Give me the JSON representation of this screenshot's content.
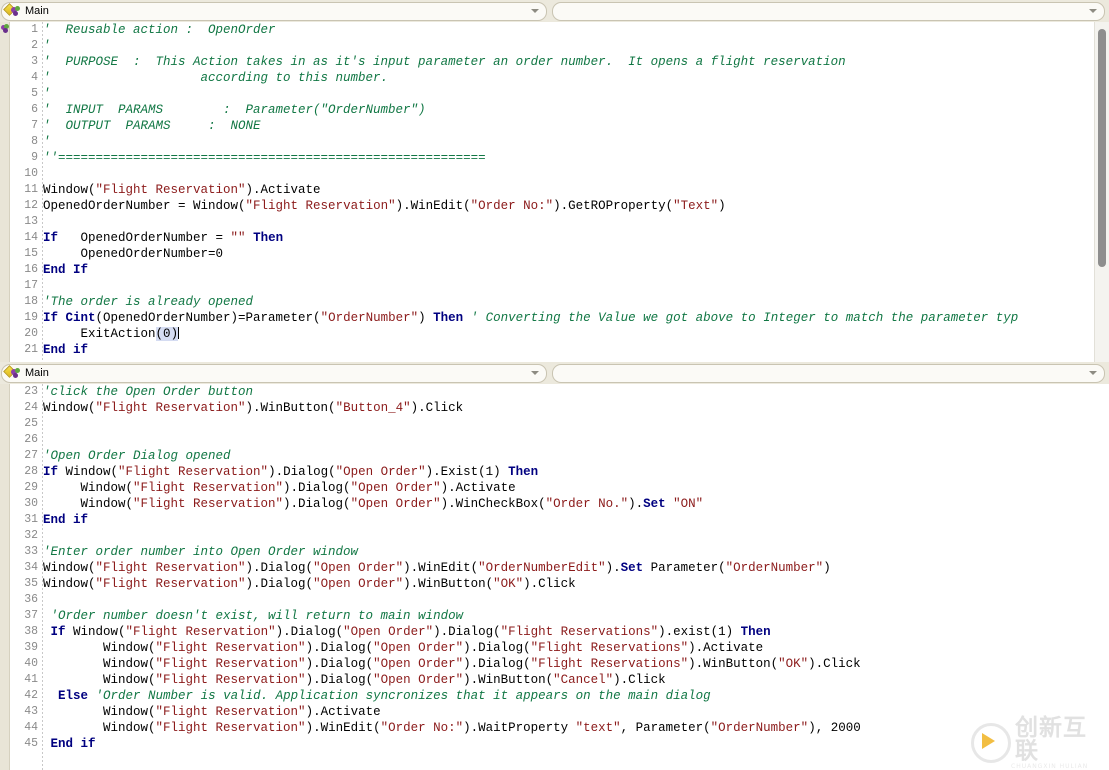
{
  "toolbar": {
    "action_combo": {
      "label": "Main",
      "icon": "action-flask-icon",
      "arrow_icon": "chevron-down-icon"
    },
    "method_combo": {
      "value": "",
      "arrow_icon": "chevron-down-icon"
    }
  },
  "pane_bottom_header": {
    "label": "Main",
    "icon": "action-flask-icon",
    "arrow_icon": "chevron-down-icon"
  },
  "editor_top": {
    "first_line_number": 1,
    "lines": [
      {
        "n": 1,
        "tokens": [
          {
            "t": "cm",
            "v": "'  Reusable action :  OpenOrder"
          }
        ]
      },
      {
        "n": 2,
        "tokens": [
          {
            "t": "cm",
            "v": "'"
          }
        ]
      },
      {
        "n": 3,
        "tokens": [
          {
            "t": "cm",
            "v": "'  PURPOSE  :  This Action takes in as it's input parameter an order number.  It opens a flight reservation"
          }
        ]
      },
      {
        "n": 4,
        "tokens": [
          {
            "t": "cm",
            "v": "'                    according to this number."
          }
        ]
      },
      {
        "n": 5,
        "tokens": [
          {
            "t": "cm",
            "v": "'"
          }
        ]
      },
      {
        "n": 6,
        "tokens": [
          {
            "t": "cm",
            "v": "'  INPUT  PARAMS        :  Parameter(\"OrderNumber\")"
          }
        ]
      },
      {
        "n": 7,
        "tokens": [
          {
            "t": "cm",
            "v": "'  OUTPUT  PARAMS     :  NONE"
          }
        ]
      },
      {
        "n": 8,
        "tokens": [
          {
            "t": "cm",
            "v": "'"
          }
        ]
      },
      {
        "n": 9,
        "tokens": [
          {
            "t": "cm",
            "v": "''========================================================="
          }
        ]
      },
      {
        "n": 10,
        "tokens": [
          {
            "t": "pl",
            "v": ""
          }
        ]
      },
      {
        "n": 11,
        "tokens": [
          {
            "t": "pl",
            "v": "Window("
          },
          {
            "t": "st",
            "v": "\"Flight Reservation\""
          },
          {
            "t": "pl",
            "v": ").Activate"
          }
        ]
      },
      {
        "n": 12,
        "tokens": [
          {
            "t": "pl",
            "v": "OpenedOrderNumber = Window("
          },
          {
            "t": "st",
            "v": "\"Flight Reservation\""
          },
          {
            "t": "pl",
            "v": ").WinEdit("
          },
          {
            "t": "st",
            "v": "\"Order No:\""
          },
          {
            "t": "pl",
            "v": ").GetROProperty("
          },
          {
            "t": "st",
            "v": "\"Text\""
          },
          {
            "t": "pl",
            "v": ")"
          }
        ]
      },
      {
        "n": 13,
        "tokens": [
          {
            "t": "pl",
            "v": ""
          }
        ]
      },
      {
        "n": 14,
        "tokens": [
          {
            "t": "kw",
            "v": "If"
          },
          {
            "t": "pl",
            "v": "   OpenedOrderNumber = "
          },
          {
            "t": "st",
            "v": "\"\""
          },
          {
            "t": "pl",
            "v": " "
          },
          {
            "t": "kw",
            "v": "Then"
          }
        ]
      },
      {
        "n": 15,
        "tokens": [
          {
            "t": "pl",
            "v": "     OpenedOrderNumber=0"
          }
        ]
      },
      {
        "n": 16,
        "tokens": [
          {
            "t": "kw",
            "v": "End If"
          }
        ]
      },
      {
        "n": 17,
        "tokens": [
          {
            "t": "pl",
            "v": ""
          }
        ]
      },
      {
        "n": 18,
        "tokens": [
          {
            "t": "cm",
            "v": "'The order is already opened"
          }
        ]
      },
      {
        "n": 19,
        "tokens": [
          {
            "t": "kw",
            "v": "If Cint"
          },
          {
            "t": "pl",
            "v": "(OpenedOrderNumber)=Parameter("
          },
          {
            "t": "st",
            "v": "\"OrderNumber\""
          },
          {
            "t": "pl",
            "v": ") "
          },
          {
            "t": "kw",
            "v": "Then"
          },
          {
            "t": "pl",
            "v": " "
          },
          {
            "t": "cm",
            "v": "' Converting the Value we got above to Integer to match the parameter typ"
          }
        ]
      },
      {
        "n": 20,
        "tokens": [
          {
            "t": "pl",
            "v": "     ExitAction"
          },
          {
            "t": "brk",
            "v": "("
          },
          {
            "t": "brk2",
            "v": "0"
          },
          {
            "t": "brk",
            "v": ")"
          },
          {
            "t": "caret",
            "v": ""
          }
        ]
      },
      {
        "n": 21,
        "tokens": [
          {
            "t": "kw",
            "v": "End if"
          }
        ]
      }
    ],
    "scrollbar": {
      "thumb_top_pct": 2,
      "thumb_height_pct": 70
    }
  },
  "editor_bottom": {
    "first_line_number": 23,
    "lines": [
      {
        "n": 23,
        "tokens": [
          {
            "t": "cm",
            "v": "'click the Open Order button"
          }
        ]
      },
      {
        "n": 24,
        "tokens": [
          {
            "t": "pl",
            "v": "Window("
          },
          {
            "t": "st",
            "v": "\"Flight Reservation\""
          },
          {
            "t": "pl",
            "v": ").WinButton("
          },
          {
            "t": "st",
            "v": "\"Button_4\""
          },
          {
            "t": "pl",
            "v": ").Click"
          }
        ]
      },
      {
        "n": 25,
        "tokens": [
          {
            "t": "pl",
            "v": ""
          }
        ]
      },
      {
        "n": 26,
        "tokens": [
          {
            "t": "pl",
            "v": ""
          }
        ]
      },
      {
        "n": 27,
        "tokens": [
          {
            "t": "cm",
            "v": "'Open Order Dialog opened"
          }
        ]
      },
      {
        "n": 28,
        "tokens": [
          {
            "t": "kw",
            "v": "If"
          },
          {
            "t": "pl",
            "v": " Window("
          },
          {
            "t": "st",
            "v": "\"Flight Reservation\""
          },
          {
            "t": "pl",
            "v": ").Dialog("
          },
          {
            "t": "st",
            "v": "\"Open Order\""
          },
          {
            "t": "pl",
            "v": ").Exist(1) "
          },
          {
            "t": "kw",
            "v": "Then"
          }
        ]
      },
      {
        "n": 29,
        "tokens": [
          {
            "t": "pl",
            "v": "     Window("
          },
          {
            "t": "st",
            "v": "\"Flight Reservation\""
          },
          {
            "t": "pl",
            "v": ").Dialog("
          },
          {
            "t": "st",
            "v": "\"Open Order\""
          },
          {
            "t": "pl",
            "v": ").Activate"
          }
        ]
      },
      {
        "n": 30,
        "tokens": [
          {
            "t": "pl",
            "v": "     Window("
          },
          {
            "t": "st",
            "v": "\"Flight Reservation\""
          },
          {
            "t": "pl",
            "v": ").Dialog("
          },
          {
            "t": "st",
            "v": "\"Open Order\""
          },
          {
            "t": "pl",
            "v": ").WinCheckBox("
          },
          {
            "t": "st",
            "v": "\"Order No.\""
          },
          {
            "t": "pl",
            "v": ")."
          },
          {
            "t": "kw",
            "v": "Set"
          },
          {
            "t": "pl",
            "v": " "
          },
          {
            "t": "st",
            "v": "\"ON\""
          }
        ]
      },
      {
        "n": 31,
        "tokens": [
          {
            "t": "kw",
            "v": "End if"
          }
        ]
      },
      {
        "n": 32,
        "tokens": [
          {
            "t": "pl",
            "v": ""
          }
        ]
      },
      {
        "n": 33,
        "tokens": [
          {
            "t": "cm",
            "v": "'Enter order number into Open Order window"
          }
        ]
      },
      {
        "n": 34,
        "tokens": [
          {
            "t": "pl",
            "v": "Window("
          },
          {
            "t": "st",
            "v": "\"Flight Reservation\""
          },
          {
            "t": "pl",
            "v": ").Dialog("
          },
          {
            "t": "st",
            "v": "\"Open Order\""
          },
          {
            "t": "pl",
            "v": ").WinEdit("
          },
          {
            "t": "st",
            "v": "\"OrderNumberEdit\""
          },
          {
            "t": "pl",
            "v": ")."
          },
          {
            "t": "kw",
            "v": "Set"
          },
          {
            "t": "pl",
            "v": " Parameter("
          },
          {
            "t": "st",
            "v": "\"OrderNumber\""
          },
          {
            "t": "pl",
            "v": ")"
          }
        ]
      },
      {
        "n": 35,
        "tokens": [
          {
            "t": "pl",
            "v": "Window("
          },
          {
            "t": "st",
            "v": "\"Flight Reservation\""
          },
          {
            "t": "pl",
            "v": ").Dialog("
          },
          {
            "t": "st",
            "v": "\"Open Order\""
          },
          {
            "t": "pl",
            "v": ").WinButton("
          },
          {
            "t": "st",
            "v": "\"OK\""
          },
          {
            "t": "pl",
            "v": ").Click"
          }
        ]
      },
      {
        "n": 36,
        "tokens": [
          {
            "t": "pl",
            "v": ""
          }
        ]
      },
      {
        "n": 37,
        "tokens": [
          {
            "t": "cm",
            "v": " 'Order number doesn't exist, will return to main window"
          }
        ]
      },
      {
        "n": 38,
        "tokens": [
          {
            "t": "pl",
            "v": " "
          },
          {
            "t": "kw",
            "v": "If"
          },
          {
            "t": "pl",
            "v": " Window("
          },
          {
            "t": "st",
            "v": "\"Flight Reservation\""
          },
          {
            "t": "pl",
            "v": ").Dialog("
          },
          {
            "t": "st",
            "v": "\"Open Order\""
          },
          {
            "t": "pl",
            "v": ").Dialog("
          },
          {
            "t": "st",
            "v": "\"Flight Reservations\""
          },
          {
            "t": "pl",
            "v": ").exist(1) "
          },
          {
            "t": "kw",
            "v": "Then"
          }
        ]
      },
      {
        "n": 39,
        "tokens": [
          {
            "t": "pl",
            "v": "        Window("
          },
          {
            "t": "st",
            "v": "\"Flight Reservation\""
          },
          {
            "t": "pl",
            "v": ").Dialog("
          },
          {
            "t": "st",
            "v": "\"Open Order\""
          },
          {
            "t": "pl",
            "v": ").Dialog("
          },
          {
            "t": "st",
            "v": "\"Flight Reservations\""
          },
          {
            "t": "pl",
            "v": ").Activate"
          }
        ]
      },
      {
        "n": 40,
        "tokens": [
          {
            "t": "pl",
            "v": "        Window("
          },
          {
            "t": "st",
            "v": "\"Flight Reservation\""
          },
          {
            "t": "pl",
            "v": ").Dialog("
          },
          {
            "t": "st",
            "v": "\"Open Order\""
          },
          {
            "t": "pl",
            "v": ").Dialog("
          },
          {
            "t": "st",
            "v": "\"Flight Reservations\""
          },
          {
            "t": "pl",
            "v": ").WinButton("
          },
          {
            "t": "st",
            "v": "\"OK\""
          },
          {
            "t": "pl",
            "v": ").Click"
          }
        ]
      },
      {
        "n": 41,
        "tokens": [
          {
            "t": "pl",
            "v": "        Window("
          },
          {
            "t": "st",
            "v": "\"Flight Reservation\""
          },
          {
            "t": "pl",
            "v": ").Dialog("
          },
          {
            "t": "st",
            "v": "\"Open Order\""
          },
          {
            "t": "pl",
            "v": ").WinButton("
          },
          {
            "t": "st",
            "v": "\"Cancel\""
          },
          {
            "t": "pl",
            "v": ").Click"
          }
        ]
      },
      {
        "n": 42,
        "tokens": [
          {
            "t": "pl",
            "v": "  "
          },
          {
            "t": "kw",
            "v": "Else"
          },
          {
            "t": "pl",
            "v": " "
          },
          {
            "t": "cm",
            "v": "'Order Number is valid. Application syncronizes that it appears on the main dialog"
          }
        ]
      },
      {
        "n": 43,
        "tokens": [
          {
            "t": "pl",
            "v": "        Window("
          },
          {
            "t": "st",
            "v": "\"Flight Reservation\""
          },
          {
            "t": "pl",
            "v": ").Activate"
          }
        ]
      },
      {
        "n": 44,
        "tokens": [
          {
            "t": "pl",
            "v": "        Window("
          },
          {
            "t": "st",
            "v": "\"Flight Reservation\""
          },
          {
            "t": "pl",
            "v": ").WinEdit("
          },
          {
            "t": "st",
            "v": "\"Order No:\""
          },
          {
            "t": "pl",
            "v": ").WaitProperty "
          },
          {
            "t": "st",
            "v": "\"text\""
          },
          {
            "t": "pl",
            "v": ", Parameter("
          },
          {
            "t": "st",
            "v": "\"OrderNumber\""
          },
          {
            "t": "pl",
            "v": "), 2000"
          }
        ]
      },
      {
        "n": 45,
        "tokens": [
          {
            "t": "pl",
            "v": " "
          },
          {
            "t": "kw",
            "v": "End if"
          }
        ]
      }
    ]
  },
  "watermark": {
    "text": "创新互联",
    "subtext": "CHUANGXIN HULIAN"
  },
  "colors": {
    "comment": "#117744",
    "keyword": "#000080",
    "string": "#8b1a1a",
    "plain": "#000000",
    "toolbar_bg": "#ece9dd",
    "margin_strip": "#e9e5d7",
    "line_number": "#8a8a8a",
    "bracket_match": "#d5dcf2"
  }
}
